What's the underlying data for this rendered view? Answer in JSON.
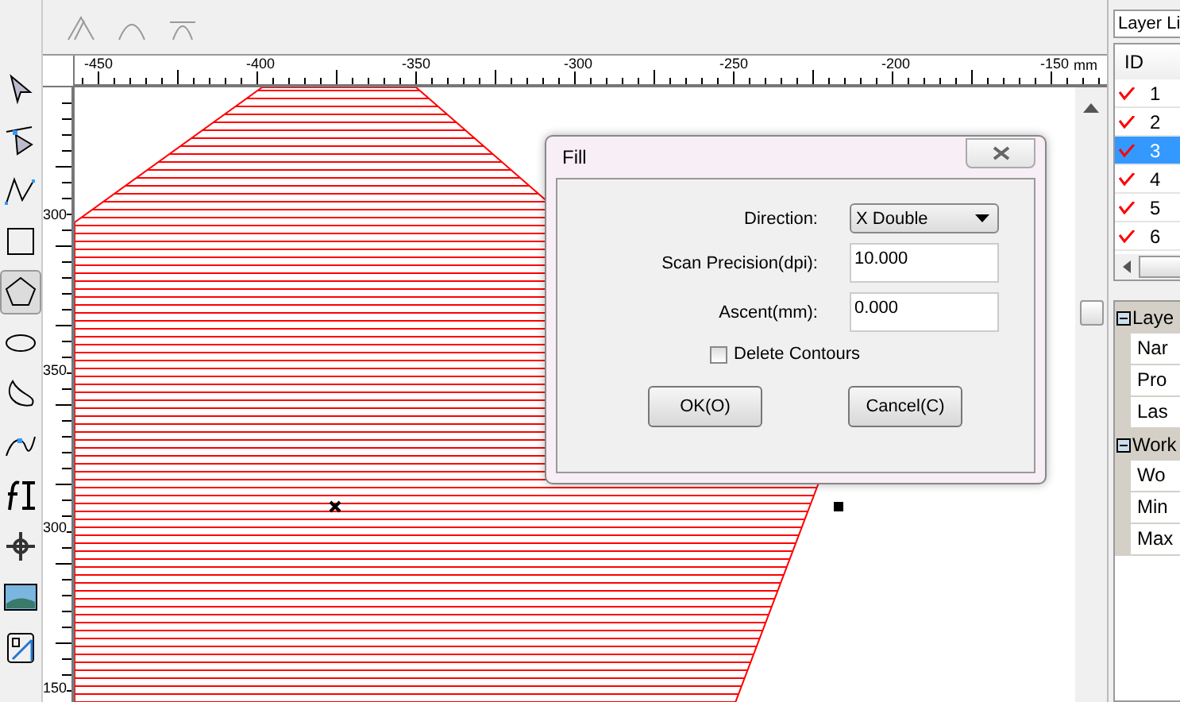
{
  "tools": [
    {
      "kind": "arrow",
      "selected": false
    },
    {
      "kind": "node-edit",
      "selected": false
    },
    {
      "kind": "polyline",
      "selected": false
    },
    {
      "kind": "rectangle",
      "selected": false
    },
    {
      "kind": "polygon",
      "selected": true
    },
    {
      "kind": "ellipse",
      "selected": false
    },
    {
      "kind": "curve",
      "selected": false
    },
    {
      "kind": "bezier",
      "selected": false
    },
    {
      "kind": "text",
      "selected": false
    },
    {
      "kind": "point",
      "selected": false
    },
    {
      "kind": "image",
      "selected": false
    },
    {
      "kind": "barcode-edit",
      "selected": false
    }
  ],
  "ruler": {
    "horizontal": [
      "-450",
      "-400",
      "-350",
      "-300",
      "-250",
      "-200",
      "-150"
    ],
    "unit": "mm",
    "vertical": [
      "300",
      "350",
      "300",
      "150"
    ]
  },
  "layer_panel": {
    "tab": "Layer Li",
    "columns": [
      "ID"
    ],
    "rows": [
      {
        "id": "1",
        "checked": true,
        "selected": false
      },
      {
        "id": "2",
        "checked": true,
        "selected": false
      },
      {
        "id": "3",
        "checked": true,
        "selected": true
      },
      {
        "id": "4",
        "checked": true,
        "selected": false
      },
      {
        "id": "5",
        "checked": true,
        "selected": false
      },
      {
        "id": "6",
        "checked": true,
        "selected": false
      }
    ]
  },
  "properties": [
    {
      "label": "Laye",
      "expanded": true,
      "children": [
        {
          "label": "Nar"
        },
        {
          "label": "Pro"
        },
        {
          "label": "Las"
        }
      ]
    },
    {
      "label": "Work",
      "expanded": true,
      "children": [
        {
          "label": "Wo"
        },
        {
          "label": "Min"
        },
        {
          "label": "Max"
        }
      ]
    }
  ],
  "dialog": {
    "title": "Fill",
    "fields": [
      {
        "kind": "select",
        "label": "Direction:",
        "value": "X Double"
      },
      {
        "kind": "input",
        "label": "Scan Precision(dpi):",
        "value": "10.000"
      },
      {
        "kind": "input",
        "label": "Ascent(mm):",
        "value": "0.000"
      }
    ],
    "checkbox": {
      "label": "Delete Contours",
      "checked": false
    },
    "buttons": [
      "OK(O)",
      "Cancel(C)"
    ]
  }
}
